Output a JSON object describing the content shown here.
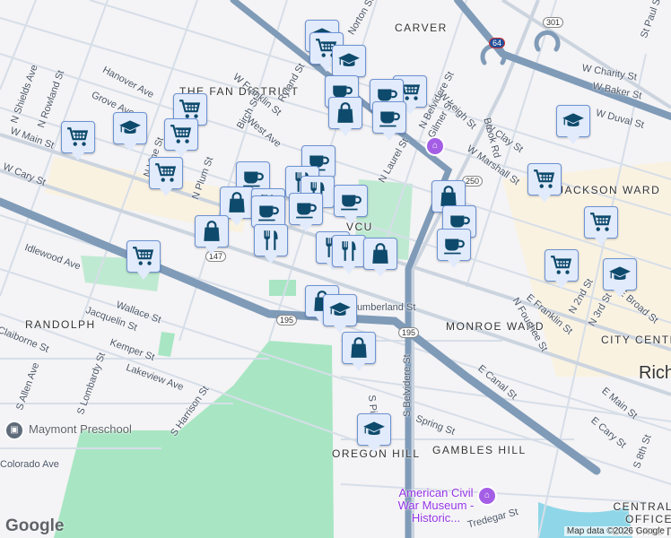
{
  "neighborhoods": [
    "THE FAN DISTRICT",
    "CARVER",
    "VCU",
    "RANDOLPH",
    "MONROE WARD",
    "CITY CENTER",
    "OREGON HILL",
    "GAMBLES HILL",
    "JACKSON WARD",
    "CENTRAL OFFICE DISTRICT"
  ],
  "streets": [
    "W Main St",
    "W Cary St",
    "Hanover Ave",
    "Grove Ave",
    "N Shields Ave",
    "N Rowland St",
    "N Vine St",
    "N Plum St",
    "Birch St",
    "West Ave",
    "W Franklin St",
    "Ryland St",
    "Norton St",
    "N Belvidere St",
    "W Leigh St",
    "W Clay St",
    "W Marshall St",
    "Brook Rd",
    "W Charity St",
    "W Baker St",
    "W Duval St",
    "Gilmer St",
    "N Laurel St",
    "Idlewood Ave",
    "Wallace St",
    "Jacquelin St",
    "Kemper St",
    "Lakeview Ave",
    "S Harrison St",
    "S Lombardy St",
    "S Allen Ave",
    "Claiborne St",
    "Colorado Ave",
    "Cumberland St",
    "S Pine St",
    "S Belvidere St",
    "Spring St",
    "E Canal St",
    "E Cary St",
    "E Main St",
    "S 8th St",
    "E Broad St",
    "N 2nd St",
    "N 3rd St",
    "E Franklin St",
    "N Foushee St",
    "Tredegar St",
    "St Paul St",
    "Richmond"
  ],
  "route_shields": [
    "195",
    "195",
    "250",
    "301",
    "64",
    "147"
  ],
  "places": {
    "preschool": "Maymont Preschool",
    "museum": "American Civil War Museum - Historic..."
  },
  "markers": [
    "cart",
    "graduation-cap",
    "coffee",
    "shopping-bag",
    "fork-knife"
  ],
  "attribution": "Map data ©2026 Google",
  "logo": "Google",
  "colors": {
    "marker_fill": "#e2ebfb",
    "marker_border": "#6c92d4",
    "icon": "#0e4a6c",
    "park": "#a8e6c3",
    "highway": "#7f9bb8"
  }
}
